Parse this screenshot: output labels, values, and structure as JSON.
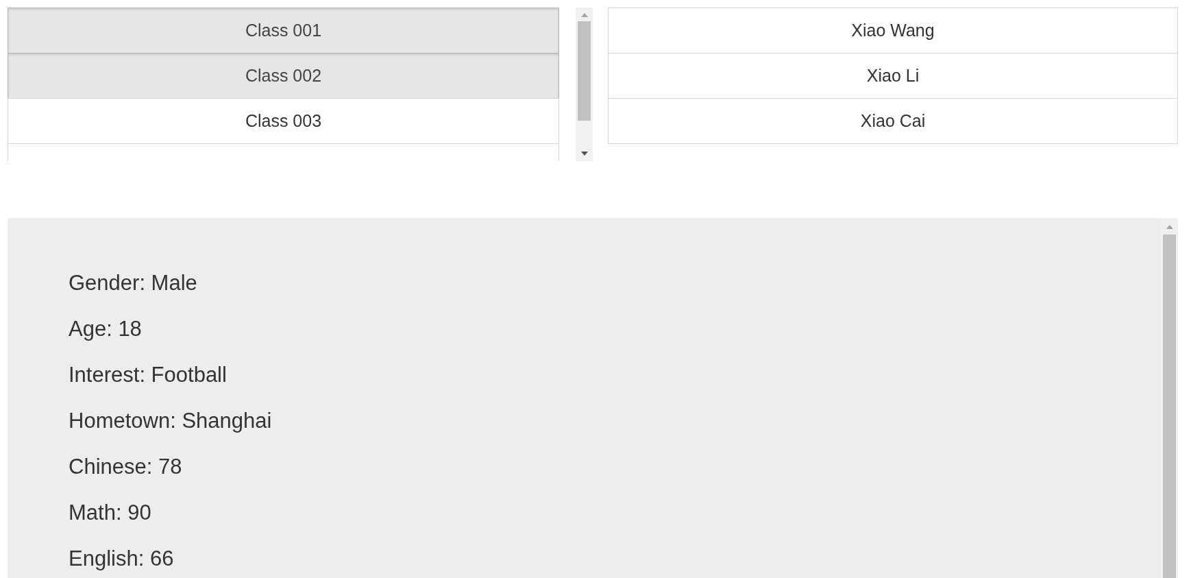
{
  "classes": [
    {
      "label": "Class 001",
      "selected": true
    },
    {
      "label": "Class 002",
      "selected": true
    },
    {
      "label": "Class 003",
      "selected": false
    }
  ],
  "students": [
    {
      "label": "Xiao Wang",
      "selected": false
    },
    {
      "label": "Xiao Li",
      "selected": false
    },
    {
      "label": "Xiao Cai",
      "selected": false
    }
  ],
  "details": [
    "Gender: Male",
    "Age: 18",
    "Interest: Football",
    "Hometown: Shanghai",
    "Chinese: 78",
    "Math: 90",
    "English: 66"
  ]
}
